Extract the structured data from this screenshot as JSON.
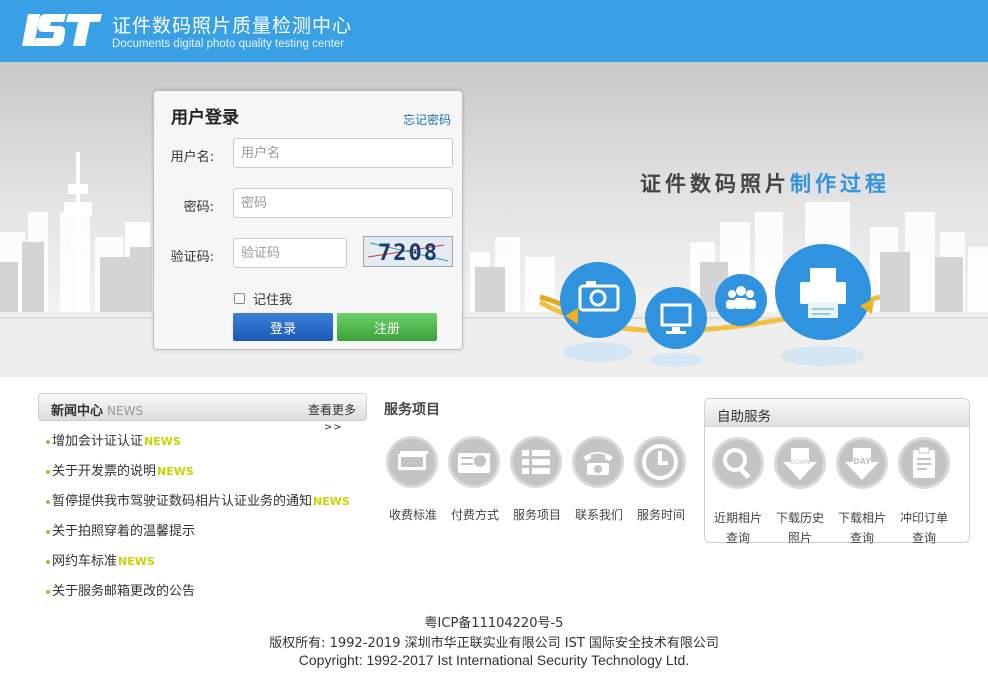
{
  "header": {
    "logo_text": "IST",
    "title_cn": "证件数码照片质量检测中心",
    "title_en": "Documents digital photo quality testing center"
  },
  "banner": {
    "process_title_main": "证件数码照片",
    "process_title_highlight": "制作过程"
  },
  "login": {
    "title": "用户登录",
    "forgot_link": "忘记密码",
    "username_label": "用户名:",
    "username_placeholder": "用户名",
    "password_label": "密码:",
    "password_placeholder": "密码",
    "captcha_label": "验证码:",
    "captcha_placeholder": "验证码",
    "captcha_text": "7208",
    "remember_label": "记住我",
    "login_button": "登录",
    "register_button": "注册"
  },
  "news": {
    "title": "新闻中心",
    "title_en": "NEWS",
    "more_label": "查看更多",
    "more_arrows": ">>",
    "items": [
      {
        "text": "增加会计证认证",
        "tag": "NEWS"
      },
      {
        "text": "关于开发票的说明",
        "tag": "NEWS"
      },
      {
        "text": "暂停提供我市驾驶证数码相片认证业务的通知",
        "tag": "NEWS"
      },
      {
        "text": "关于拍照穿着的温馨提示",
        "tag": ""
      },
      {
        "text": "网约车标准",
        "tag": "NEWS"
      },
      {
        "text": "关于服务邮箱更改的公告",
        "tag": ""
      }
    ]
  },
  "services": {
    "title": "服务项目",
    "items": [
      {
        "label": "收费标准",
        "icon": "money-icon"
      },
      {
        "label": "付费方式",
        "icon": "payment-icon"
      },
      {
        "label": "服务项目",
        "icon": "list-icon"
      },
      {
        "label": "联系我们",
        "icon": "telephone-icon"
      },
      {
        "label": "服务时间",
        "icon": "clock-icon"
      }
    ]
  },
  "self_service": {
    "title": "自助服务",
    "items": [
      {
        "line1": "近期相片",
        "line2": "查询",
        "icon": "magnifier-icon"
      },
      {
        "line1": "下载历史",
        "line2": "照片",
        "icon": "download-icon"
      },
      {
        "line1": "下载相片",
        "line2": "查询",
        "icon": "download-day-icon"
      },
      {
        "line1": "冲印订单",
        "line2": "查询",
        "icon": "clipboard-icon"
      }
    ]
  },
  "footer": {
    "icp": "粤ICP备11104220号-5",
    "copyright_cn": "版权所有: 1992-2019 深圳市华正联实业有限公司 IST 国际安全技术有限公司",
    "copyright_en": "Copyright: 1992-2017 Ist International Security Technology Ltd."
  },
  "colors": {
    "header_blue": "#3aa0e6",
    "login_button": "#1a59b8",
    "register_button": "#3aa33a",
    "news_tag": "#c8d400",
    "process_highlight": "#2f93e0"
  }
}
